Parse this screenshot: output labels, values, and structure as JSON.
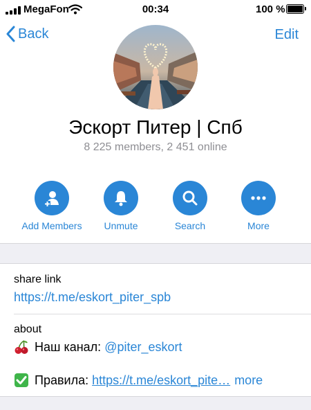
{
  "status_bar": {
    "carrier": "MegaFon",
    "time": "00:34",
    "battery": "100 %"
  },
  "nav": {
    "back_label": "Back",
    "edit_label": "Edit"
  },
  "group": {
    "title": "Эскорт Питер | Спб",
    "subtitle": "8 225 members, 2 451 online"
  },
  "actions": [
    {
      "label": "Add Members",
      "icon": "add-member-icon"
    },
    {
      "label": "Unmute",
      "icon": "bell-icon"
    },
    {
      "label": "Search",
      "icon": "search-icon"
    },
    {
      "label": "More",
      "icon": "more-dots-icon"
    }
  ],
  "share": {
    "label": "share link",
    "url": "https://t.me/eskort_piter_spb"
  },
  "about": {
    "label": "about",
    "line1_prefix": "Наш канал: ",
    "line1_link": "@piter_eskort",
    "line2_prefix": "Правила: ",
    "line2_link": "https://t.me/eskort_pite…",
    "more": "more"
  },
  "colors": {
    "accent": "#2a86d6",
    "secondary_text": "#8e8e93",
    "separator_bg": "#efeff4"
  }
}
